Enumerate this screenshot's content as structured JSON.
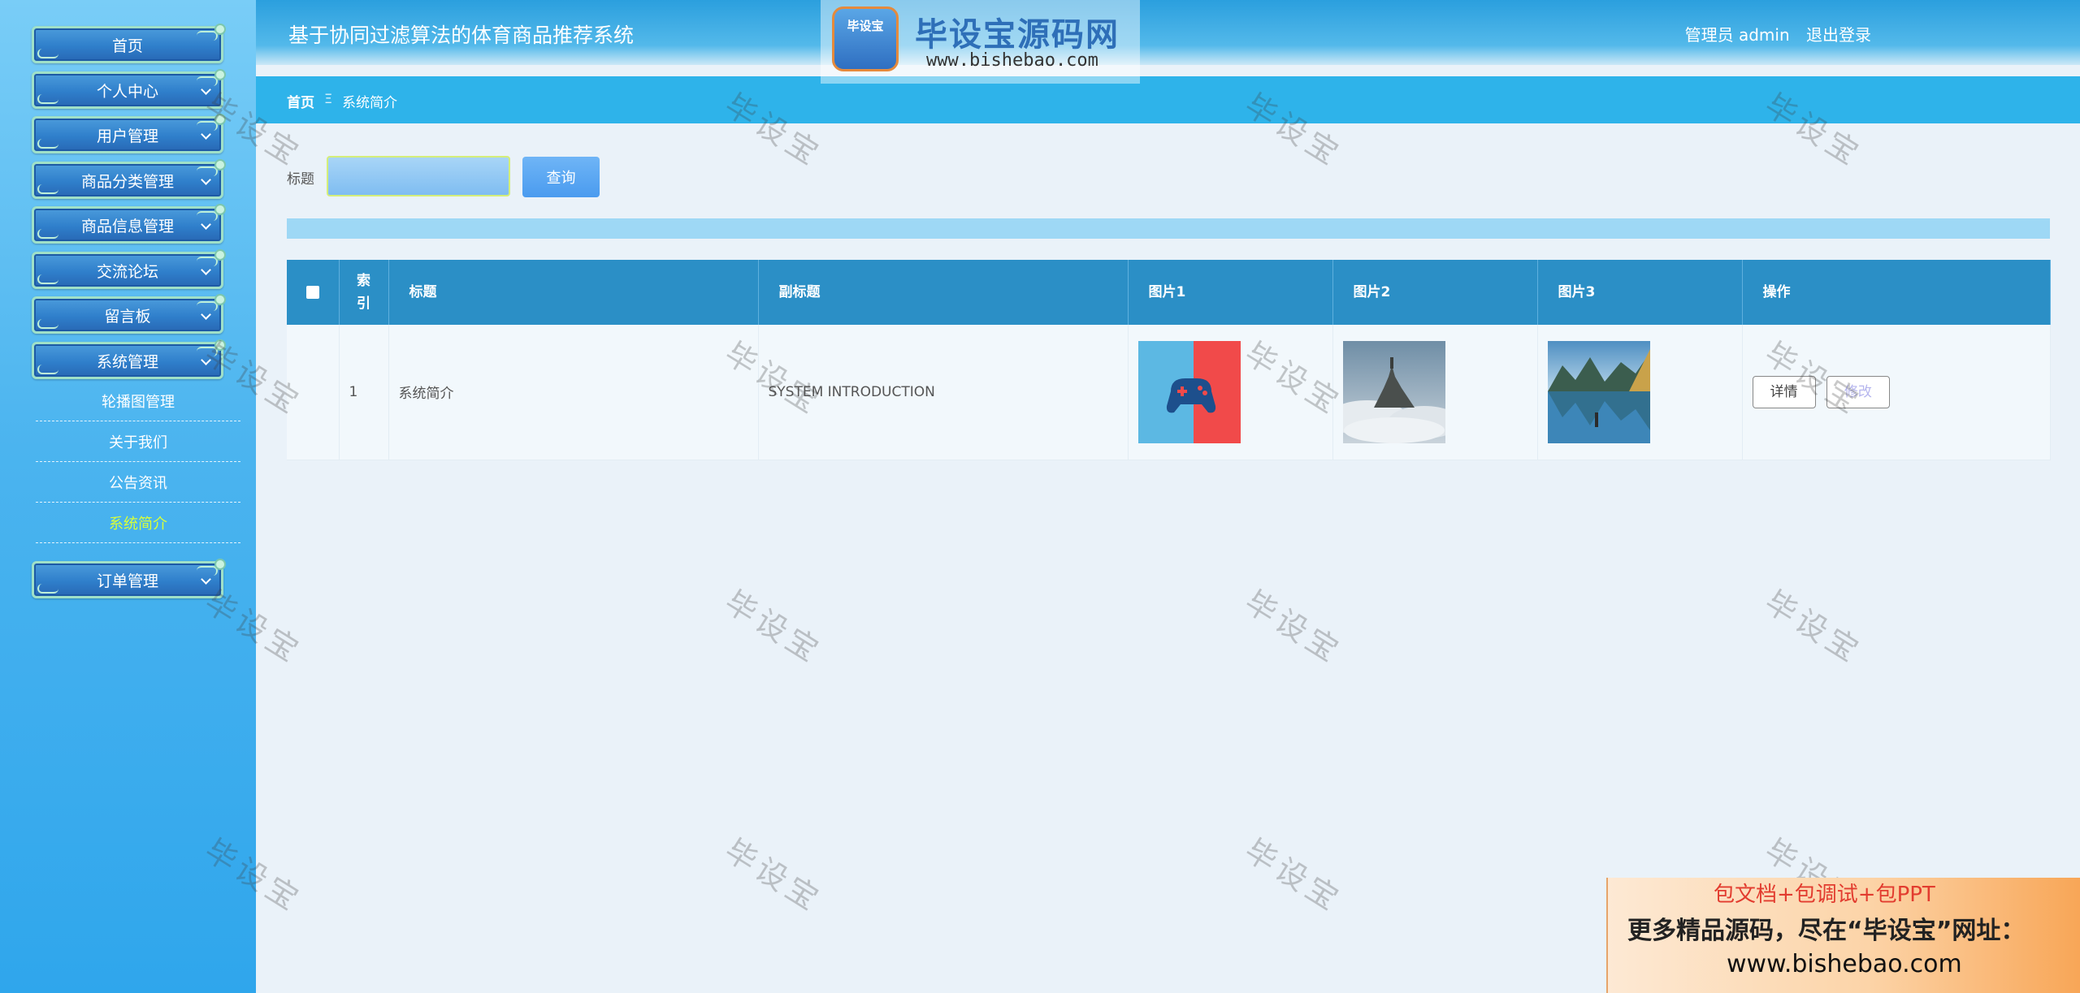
{
  "app": {
    "title": "基于协同过滤算法的体育商品推荐系统",
    "user_label": "管理员 admin",
    "logout_label": "退出登录"
  },
  "breadcrumb": {
    "home": "首页",
    "separator": "Ξ",
    "current": "系统简介"
  },
  "watermark": {
    "logo_badge": "毕设宝",
    "logo_text": "毕设宝源码网",
    "logo_url": "www.bishebao.com",
    "stamp": "毕设宝"
  },
  "sidebar": {
    "items": [
      {
        "label": "首页"
      },
      {
        "label": "个人中心"
      },
      {
        "label": "用户管理"
      },
      {
        "label": "商品分类管理"
      },
      {
        "label": "商品信息管理"
      },
      {
        "label": "交流论坛"
      },
      {
        "label": "留言板"
      },
      {
        "label": "系统管理"
      }
    ],
    "submenu": [
      {
        "label": "轮播图管理"
      },
      {
        "label": "关于我们"
      },
      {
        "label": "公告资讯"
      },
      {
        "label": "系统简介"
      }
    ],
    "last_item": {
      "label": "订单管理"
    }
  },
  "search": {
    "label": "标题",
    "placeholder": "",
    "button": "查询"
  },
  "table": {
    "headers": {
      "index": "索引",
      "title": "标题",
      "subtitle": "副标题",
      "image1": "图片1",
      "image2": "图片2",
      "image3": "图片3",
      "actions": "操作"
    },
    "rows": [
      {
        "index": "1",
        "title": "系统简介",
        "subtitle": "SYSTEM INTRODUCTION",
        "detail_label": "详情",
        "edit_label": "修改"
      }
    ]
  },
  "ad": {
    "line1": "包文档+包调试+包PPT",
    "line2": "更多精品源码，尽在“毕设宝”网址：",
    "line3": "www.bishebao.com"
  },
  "colors": {
    "sidebar": "#4bb4ef",
    "header": "#2b9fde",
    "table_header": "#2b8fc6",
    "active_submenu": "#d8ff3a"
  }
}
